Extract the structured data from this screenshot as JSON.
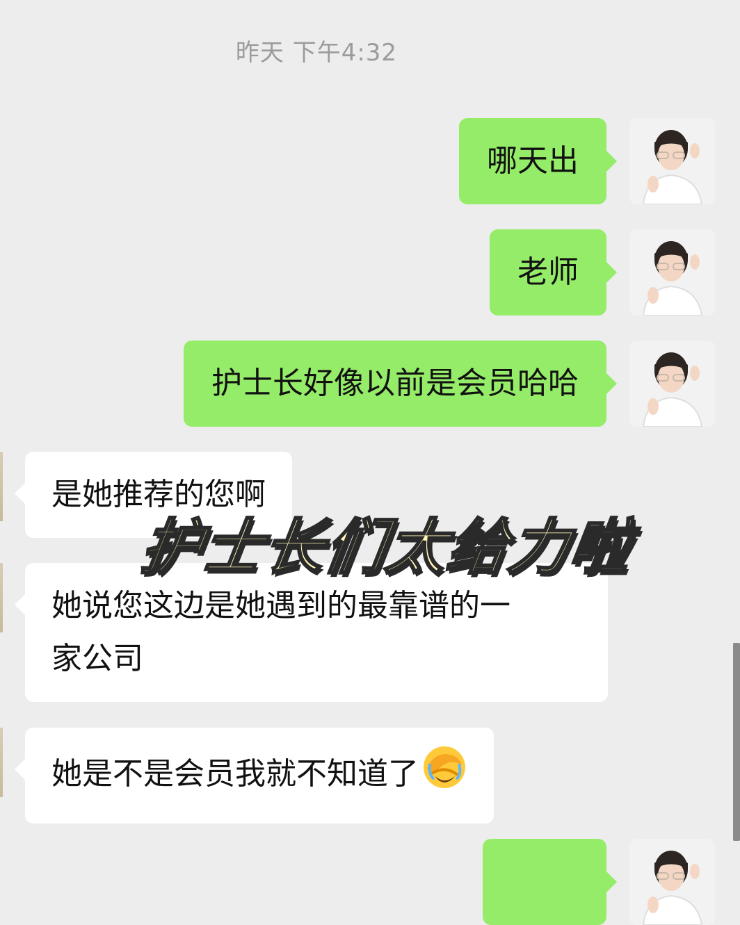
{
  "chat": {
    "timestamp": "昨天 下午4:32",
    "messages": [
      {
        "side": "out",
        "text": "哪天出"
      },
      {
        "side": "out",
        "text": "老师"
      },
      {
        "side": "out",
        "text": "护士长好像以前是会员哈哈"
      },
      {
        "side": "in",
        "text": "是她推荐的您啊"
      },
      {
        "side": "in",
        "lines": [
          "她说您这边是她遇到的最靠谱的一",
          "家公司"
        ]
      },
      {
        "side": "in",
        "text": "她是不是会员我就不知道了",
        "emoji": "facepalm-emoji"
      }
    ],
    "overlay_caption": "护士长们太给力啦"
  },
  "colors": {
    "background": "#ededed",
    "outgoing_bubble": "#95ec69",
    "incoming_bubble": "#ffffff",
    "caption_fill": "#fff7b8",
    "caption_stroke": "#2a2a2a"
  }
}
